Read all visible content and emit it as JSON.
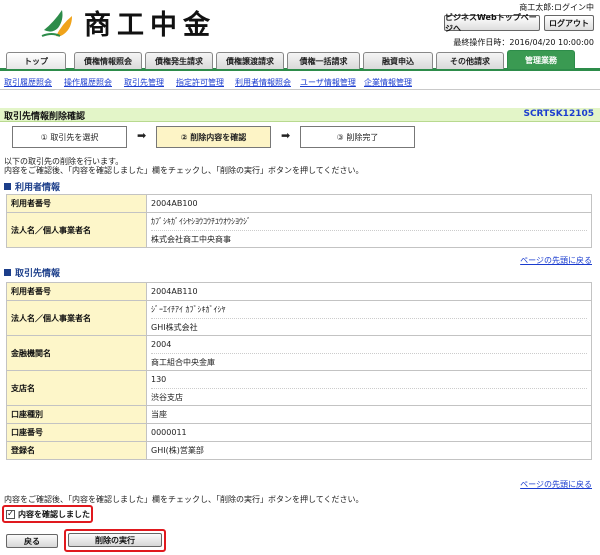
{
  "header": {
    "logo_text": "商工中金",
    "user_status": "商工太郎:ログイン中",
    "top_page_button": "ビジネスWebトップページへ",
    "logout_button": "ログアウト",
    "last_login": "最終操作日時：2016/04/20 10:00:00"
  },
  "tabs": [
    {
      "label": "トップ"
    },
    {
      "label": "債権情報照会"
    },
    {
      "label": "債権発生請求"
    },
    {
      "label": "債権譲渡請求"
    },
    {
      "label": "債権一括請求"
    },
    {
      "label": "融資申込"
    },
    {
      "label": "その他請求"
    },
    {
      "label": "管理業務"
    }
  ],
  "subnav": [
    {
      "label": "取引履歴照会"
    },
    {
      "label": "操作履歴照会"
    },
    {
      "label": "取引先管理"
    },
    {
      "label": "指定許可管理"
    },
    {
      "label": "利用者情報照会"
    },
    {
      "label": "ユーザ情報管理"
    },
    {
      "label": "企業情報管理"
    }
  ],
  "page": {
    "title": "取引先情報削除確認",
    "screen_code": "SCRTSK12105"
  },
  "steps": [
    {
      "label": "① 取引先を選択"
    },
    {
      "label": "② 削除内容を確認"
    },
    {
      "label": "③ 削除完了"
    }
  ],
  "instructions": {
    "line1": "以下の取引先の削除を行います。",
    "line2": "内容をご確認後、「内容を確認しました」欄をチェックし、「削除の実行」ボタンを押してください。",
    "bottom": "内容をご確認後、「内容を確認しました」欄をチェックし、「削除の実行」ボタンを押してください。"
  },
  "user_info": {
    "heading": "利用者情報",
    "rows": [
      {
        "label": "利用者番号",
        "values": [
          "2004AB100"
        ]
      },
      {
        "label": "法人名／個人事業者名",
        "values": [
          "ｶﾌﾞｼｷｶﾞｲｼﾔｼﾖｳｺｳﾁﾕｳｵｳｼﾖｳｼﾞ",
          "株式会社商工中央商事"
        ]
      }
    ]
  },
  "partner_info": {
    "heading": "取引先情報",
    "rows": [
      {
        "label": "利用者番号",
        "values": [
          "2004AB110"
        ]
      },
      {
        "label": "法人名／個人事業者名",
        "values": [
          "ｼﾞｰｴｲﾁｱｲ ｶﾌﾞｼｷｶﾞｲｼﾔ",
          "GHI株式会社"
        ]
      },
      {
        "label": "金融機関名",
        "values": [
          "2004",
          "商工組合中央金庫"
        ]
      },
      {
        "label": "支店名",
        "values": [
          "130",
          "渋谷支店"
        ]
      },
      {
        "label": "口座種別",
        "values": [
          "当座"
        ]
      },
      {
        "label": "口座番号",
        "values": [
          "0000011"
        ]
      },
      {
        "label": "登録名",
        "values": [
          "GHI(株)営業部"
        ]
      }
    ]
  },
  "to_top_link": "ページの先頭に戻る",
  "confirm": {
    "label": "内容を確認しました",
    "checked": true,
    "checkmark": "✓"
  },
  "buttons": {
    "back": "戻る",
    "execute": "削除の実行"
  },
  "colors": {
    "brand_green": "#3a9a52",
    "highlight_red": "#e0191e",
    "label_bg": "#fdf6c9",
    "link_blue": "#1a3ccf"
  }
}
